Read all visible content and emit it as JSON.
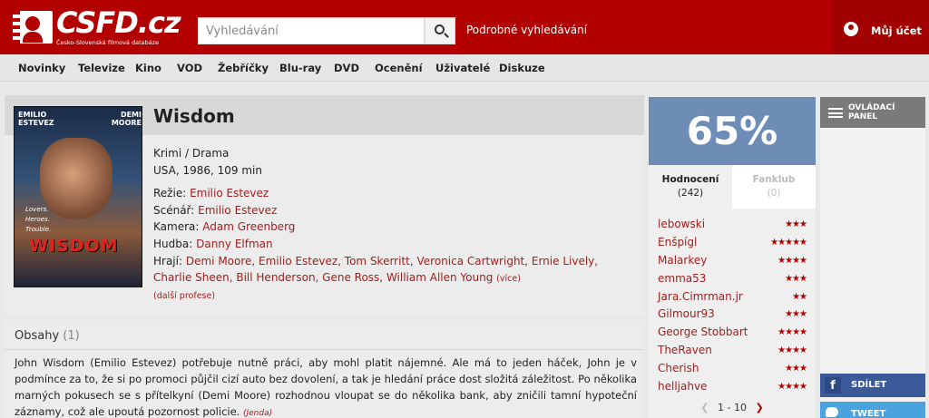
{
  "header": {
    "logo_text": "CSFD.cz",
    "logo_subtitle": "Česko-Slovenská filmová databáze",
    "search_placeholder": "Vyhledávání",
    "advanced_search": "Podrobné vyhledávání",
    "account": "Můj účet"
  },
  "nav": {
    "items": [
      "Novinky",
      "Televize",
      "Kino",
      "VOD",
      "Žebříčky",
      "Blu-ray",
      "DVD",
      "Ocenění",
      "Uživatelé",
      "Diskuze"
    ]
  },
  "film": {
    "title": "Wisdom",
    "genre": "Krimi / Drama",
    "origin": "USA, 1986, 109 min",
    "poster": {
      "name_left": "EMILIO ESTEVEZ",
      "name_right": "DEMI MOORE",
      "tagline": [
        "Lovers.",
        "Heroes.",
        "Trouble."
      ],
      "title": "WISDOM"
    },
    "director_label": "Režie:",
    "director": "Emilio Estevez",
    "writer_label": "Scénář:",
    "writer": "Emilio Estevez",
    "camera_label": "Kamera:",
    "camera": "Adam Greenberg",
    "music_label": "Hudba:",
    "music": "Danny Elfman",
    "cast_label": "Hrají:",
    "cast": "Demi Moore, Emilio Estevez, Tom Skerritt, Veronica Cartwright, Ernie Lively, Charlie Sheen, Bill Henderson, Gene Ross, William Allen Young",
    "more": "(více)",
    "other_professions": "(další profese)"
  },
  "plot": {
    "title": "Obsahy",
    "count": "(1)",
    "text": "John Wisdom (Emilio Estevez) potřebuje nutně práci, aby mohl platit nájemné. Ale má to jeden háček, John je v podmínce za to, že si po promoci půjčil cizí auto bez dovolení, a tak je hledání práce dost složitá záležitost. Po několika marných pokusech se s přítelkyní (Demi Moore) rozhodnou vloupat se do několika bank, aby zničili tamní hypoteční záznamy, což ale upoutá pozornost policie.",
    "author": "(Jenda)"
  },
  "rating": {
    "score": "65%",
    "tab_ratings": "Hodnocení",
    "tab_ratings_count": "(242)",
    "tab_fanclub": "Fanklub",
    "tab_fanclub_count": "(0)",
    "users": [
      {
        "name": "lebowski",
        "stars": "★★★"
      },
      {
        "name": "Enšpígl",
        "stars": "★★★★★"
      },
      {
        "name": "Malarkey",
        "stars": "★★★★"
      },
      {
        "name": "emma53",
        "stars": "★★★"
      },
      {
        "name": "Jara.Cimrman.jr",
        "stars": "★★"
      },
      {
        "name": "Gilmour93",
        "stars": "★★★"
      },
      {
        "name": "George Stobbart",
        "stars": "★★★★"
      },
      {
        "name": "TheRaven",
        "stars": "★★★★"
      },
      {
        "name": "Cherish",
        "stars": "★★★"
      },
      {
        "name": "helljahve",
        "stars": "★★★★"
      }
    ],
    "pager": "1 - 10"
  },
  "sidebar": {
    "control_panel": "OVLÁDACÍ PANEL",
    "share": "SDÍLET",
    "tweet": "TWEET"
  },
  "colors": {
    "brand_red": "#b20000",
    "score_blue": "#6d8db6",
    "link_red": "#a11e1e",
    "facebook": "#3a5a99",
    "twitter": "#4aa3df"
  }
}
